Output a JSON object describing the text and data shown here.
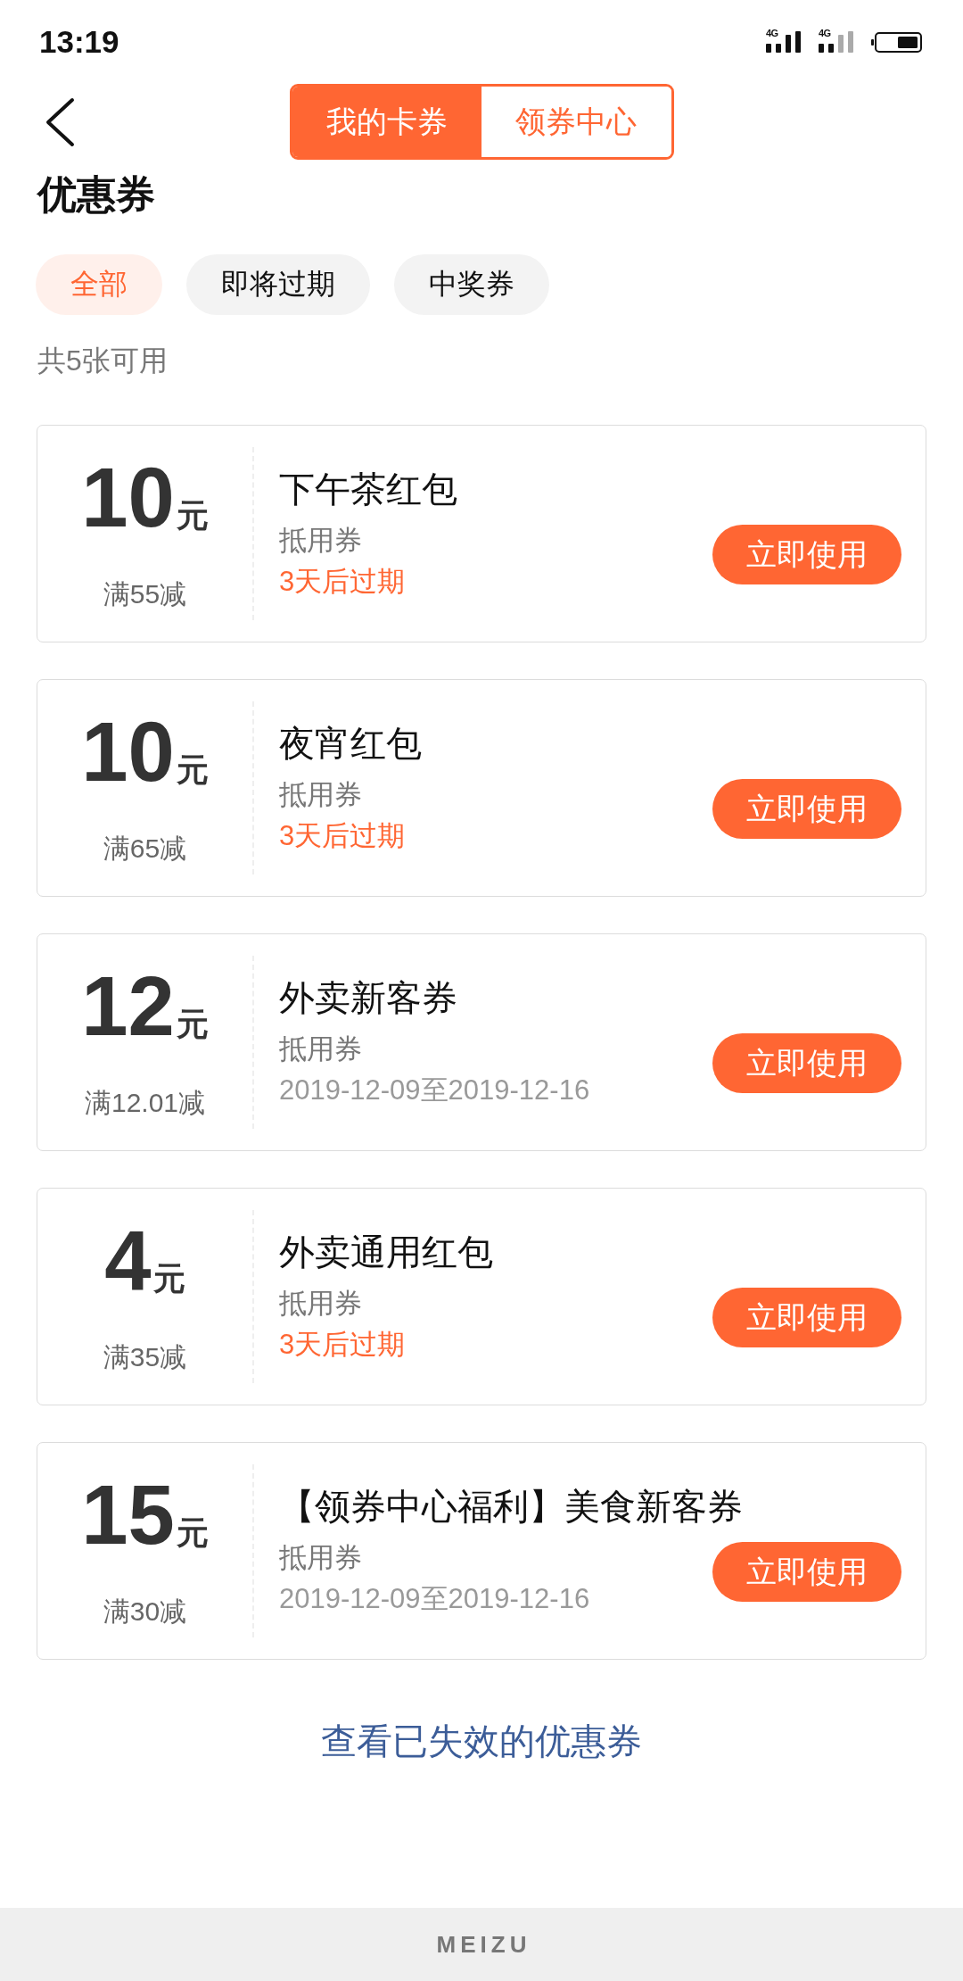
{
  "status_bar": {
    "time": "13:19",
    "networks": [
      {
        "type": "4G"
      },
      {
        "type": "4G"
      }
    ]
  },
  "header": {
    "tabs": [
      {
        "label": "我的卡券",
        "selected": true
      },
      {
        "label": "领券中心",
        "selected": false
      }
    ]
  },
  "page_title": "优惠券",
  "filters": [
    {
      "label": "全部",
      "selected": true
    },
    {
      "label": "即将过期",
      "selected": false
    },
    {
      "label": "中奖券",
      "selected": false
    }
  ],
  "count_text": "共5张可用",
  "coupons": [
    {
      "amount": "10",
      "unit": "元",
      "condition": "满55减",
      "title": "下午茶红包",
      "type": "抵用券",
      "validity": "3天后过期",
      "expiring": true,
      "button": "立即使用"
    },
    {
      "amount": "10",
      "unit": "元",
      "condition": "满65减",
      "title": "夜宵红包",
      "type": "抵用券",
      "validity": "3天后过期",
      "expiring": true,
      "button": "立即使用"
    },
    {
      "amount": "12",
      "unit": "元",
      "condition": "满12.01减",
      "title": "外卖新客券",
      "type": "抵用券",
      "validity": "2019-12-09至2019-12-16",
      "expiring": false,
      "button": "立即使用"
    },
    {
      "amount": "4",
      "unit": "元",
      "condition": "满35减",
      "title": "外卖通用红包",
      "type": "抵用券",
      "validity": "3天后过期",
      "expiring": true,
      "button": "立即使用"
    },
    {
      "amount": "15",
      "unit": "元",
      "condition": "满30减",
      "title": "【领券中心福利】美食新客券",
      "type": "抵用券",
      "validity": "2019-12-09至2019-12-16",
      "expiring": false,
      "button": "立即使用"
    }
  ],
  "footer_link": "查看已失效的优惠券",
  "nav_bar": {
    "brand": "MEIZU"
  }
}
